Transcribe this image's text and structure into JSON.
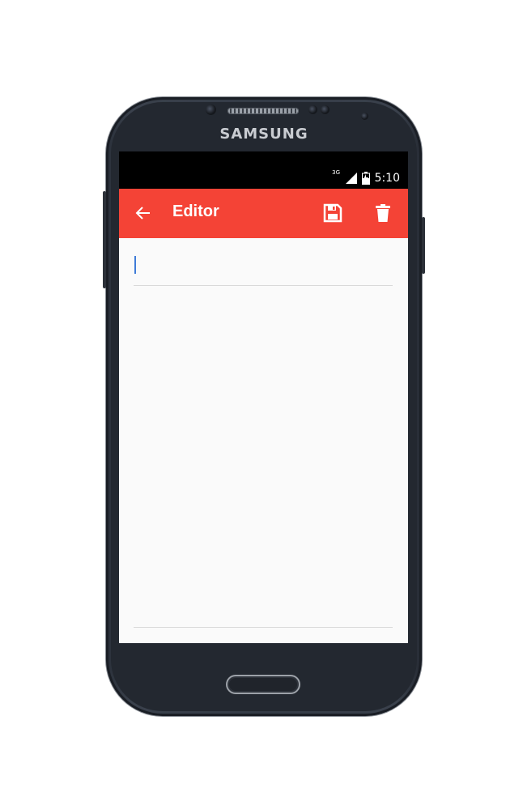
{
  "device": {
    "brand": "SAMSUNG"
  },
  "status_bar": {
    "network": "3G",
    "time": "5:10"
  },
  "toolbar": {
    "title": "Editor",
    "background_color": "#f44336",
    "back_icon": "arrow-left-icon",
    "save_icon": "floppy-disk-icon",
    "delete_icon": "trash-icon"
  },
  "editor": {
    "title_value": "",
    "body_value": "",
    "cursor_color": "#3f7bd8"
  }
}
